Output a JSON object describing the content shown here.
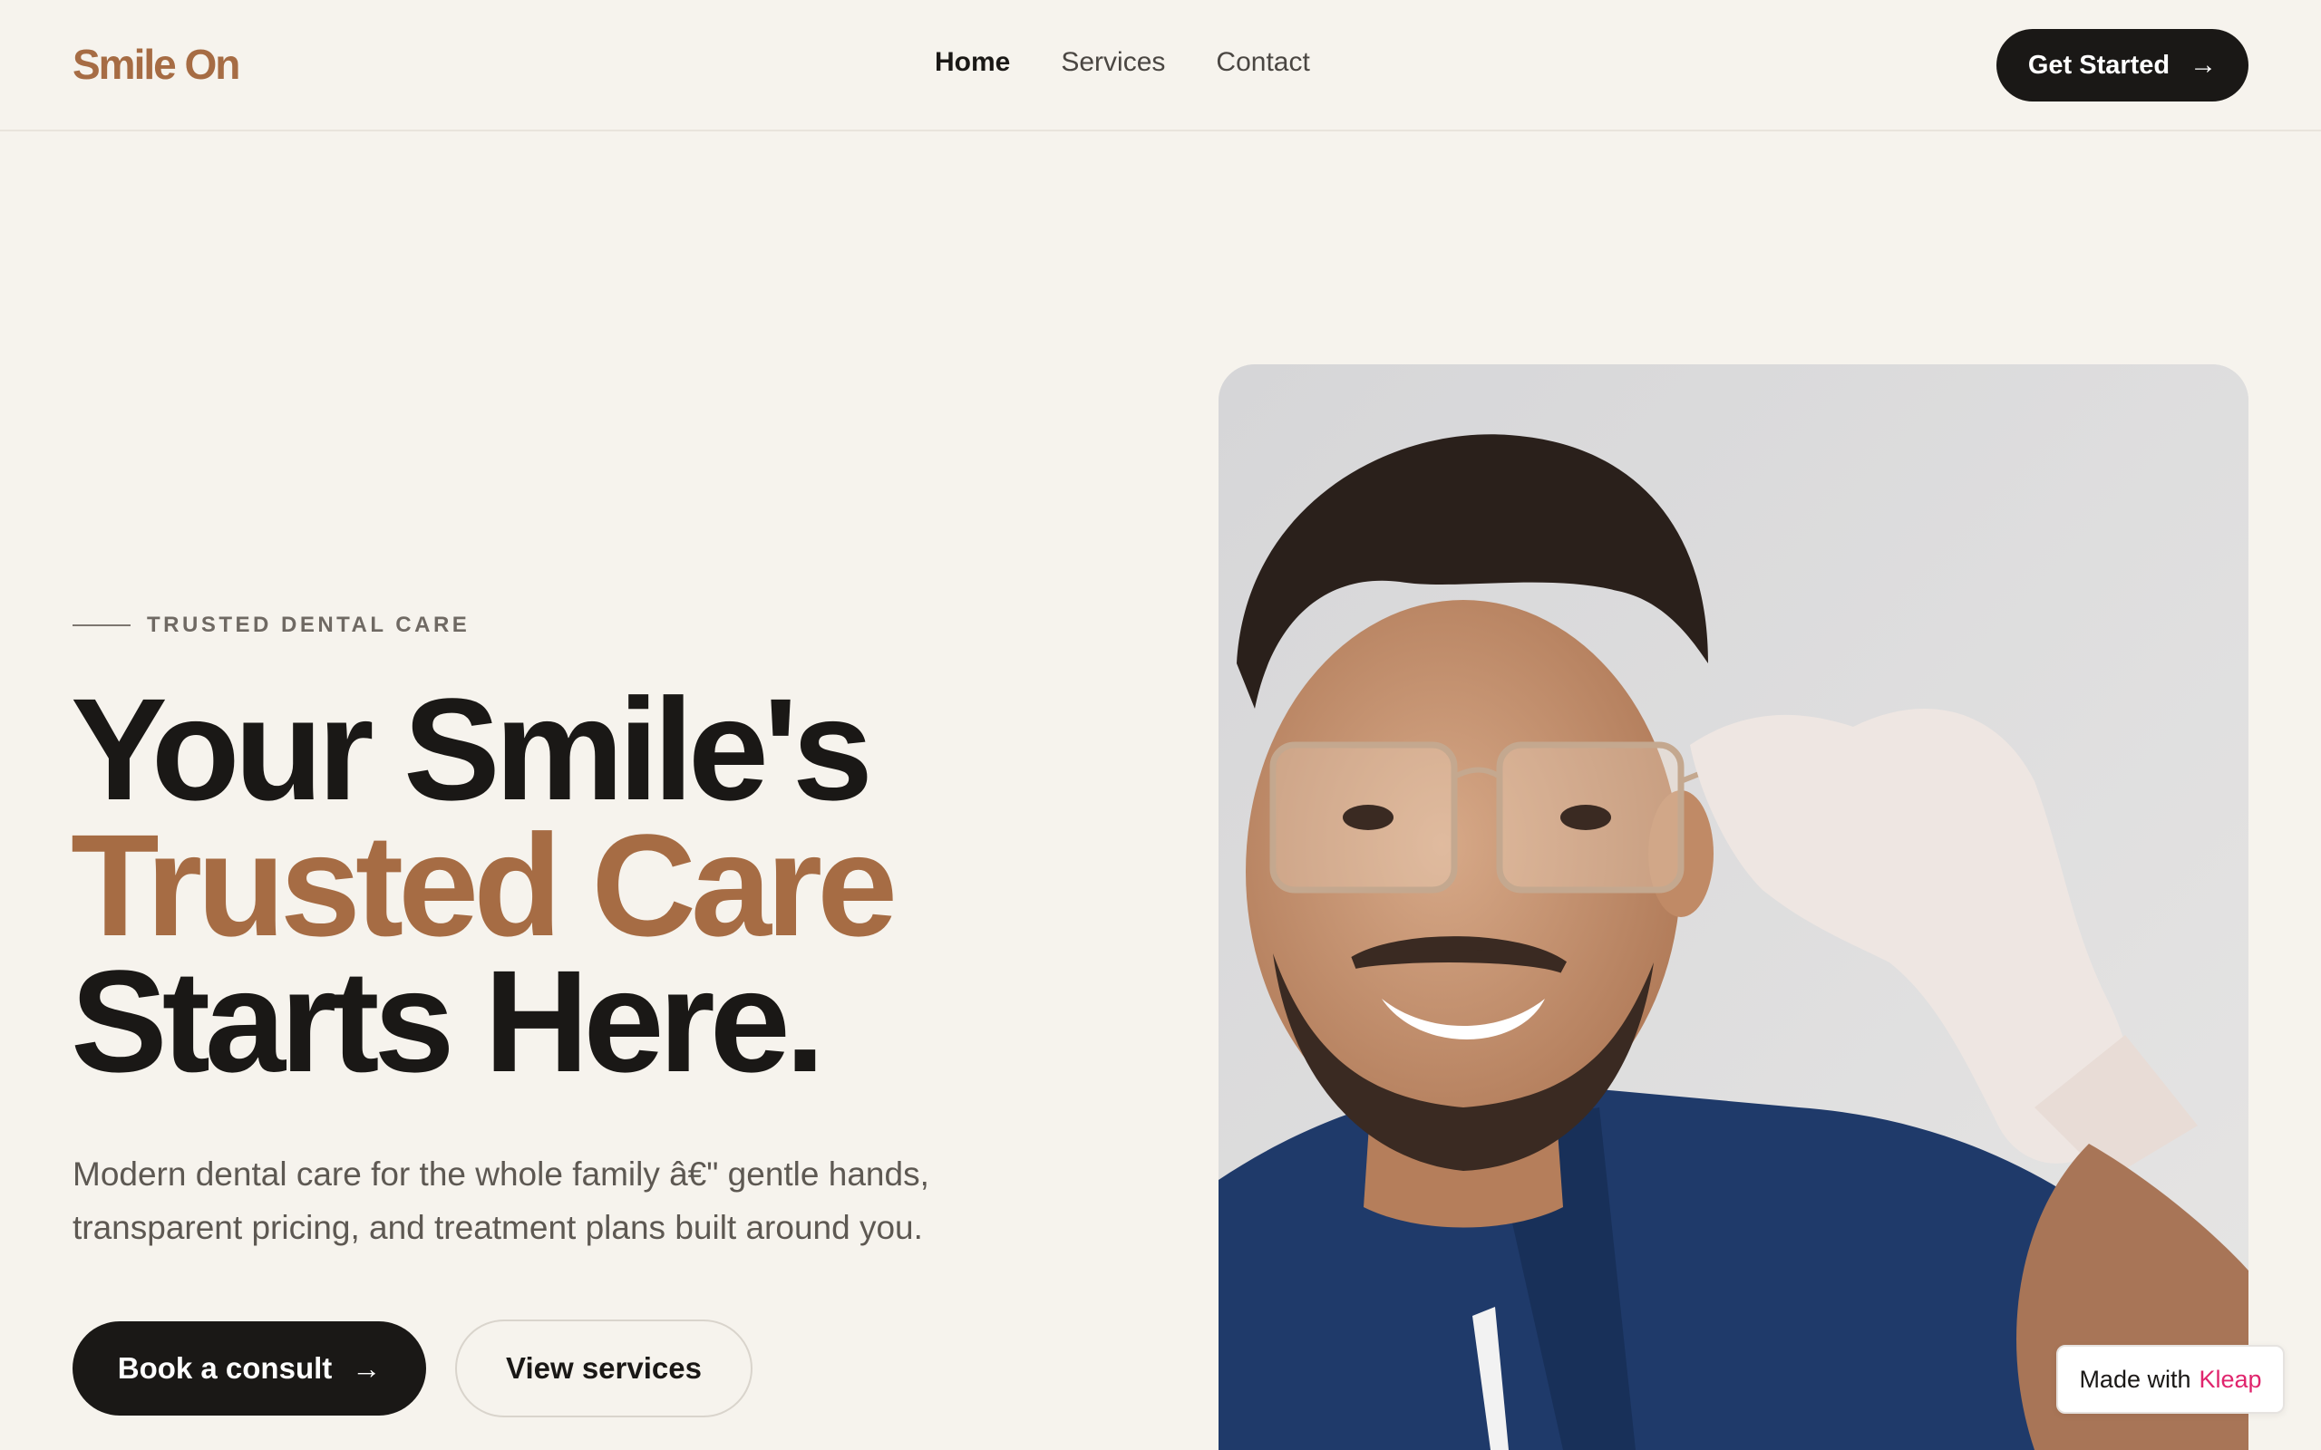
{
  "header": {
    "logo": "Smile On",
    "nav": [
      "Home",
      "Services",
      "Contact"
    ],
    "cta_label": "Get Started"
  },
  "hero": {
    "eyebrow": "TRUSTED DENTAL CARE",
    "headline_line1": "Your Smile's",
    "headline_line2": "Trusted Care",
    "headline_line3": "Starts Here.",
    "description": "Modern dental care for the whole family â€\" gentle hands, transparent pricing, and treatment plans built around you.",
    "primary_button": "Book a consult",
    "secondary_button": "View services"
  },
  "badge": {
    "prefix": "Made with",
    "brand": "Kleap"
  },
  "icons": {
    "arrow": "arrow-right-icon"
  },
  "colors": {
    "background": "#f6f3ed",
    "accent": "#a66c44",
    "dark": "#1a1816",
    "badge_brand": "#e0256d"
  }
}
